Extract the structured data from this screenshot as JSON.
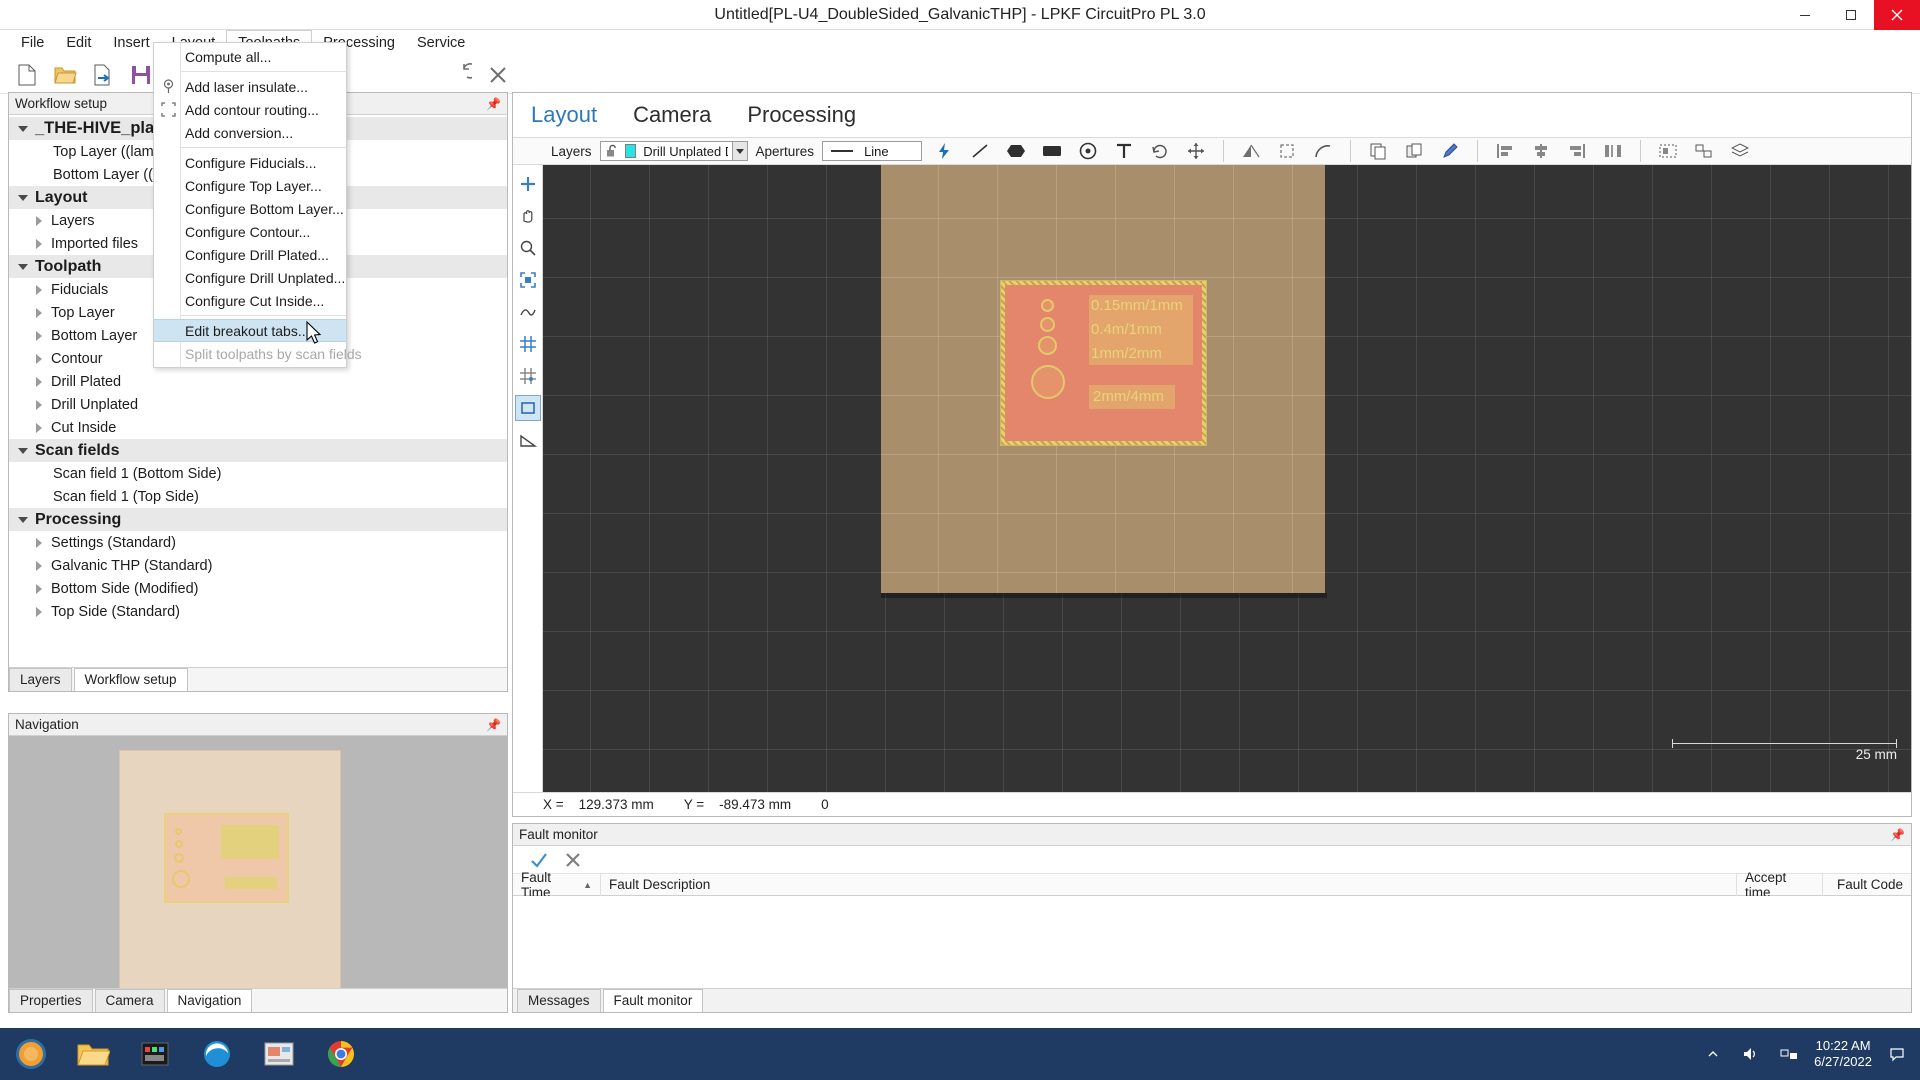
{
  "window": {
    "title": "Untitled[PL-U4_DoubleSided_GalvanicTHP] - LPKF CircuitPro PL 3.0",
    "minimize_label": "—",
    "maximize_label": "□",
    "close_label": "✕"
  },
  "menubar": {
    "items": [
      {
        "label": "File",
        "open": false
      },
      {
        "label": "Edit",
        "open": false
      },
      {
        "label": "Insert",
        "open": false
      },
      {
        "label": "Layout",
        "open": false
      },
      {
        "label": "Toolpaths",
        "open": true
      },
      {
        "label": "Processing",
        "open": false
      },
      {
        "label": "Service",
        "open": false
      }
    ]
  },
  "dropdown": {
    "owner": "Toolpaths",
    "items": [
      {
        "label": "Compute all...",
        "icon": "",
        "state": "normal"
      },
      {
        "separator": true
      },
      {
        "label": "Add laser insulate...",
        "icon": "laser-insulate-icon",
        "state": "normal"
      },
      {
        "label": "Add contour routing...",
        "icon": "contour-routing-icon",
        "state": "normal"
      },
      {
        "label": "Add conversion...",
        "icon": "",
        "state": "normal"
      },
      {
        "separator": true
      },
      {
        "label": "Configure Fiducials...",
        "icon": "",
        "state": "normal"
      },
      {
        "label": "Configure Top Layer...",
        "icon": "",
        "state": "normal"
      },
      {
        "label": "Configure Bottom Layer...",
        "icon": "",
        "state": "normal"
      },
      {
        "label": "Configure Contour...",
        "icon": "",
        "state": "normal"
      },
      {
        "label": "Configure Drill Plated...",
        "icon": "",
        "state": "normal"
      },
      {
        "label": "Configure Drill Unplated...",
        "icon": "",
        "state": "normal"
      },
      {
        "label": "Configure Cut Inside...",
        "icon": "",
        "state": "normal"
      },
      {
        "separator": true
      },
      {
        "label": "Edit breakout tabs...",
        "icon": "",
        "state": "highlighted"
      },
      {
        "label": "Split toolpaths by scan fields",
        "icon": "",
        "state": "disabled"
      }
    ]
  },
  "toolbar": {
    "buttons": [
      {
        "name": "new-document-icon"
      },
      {
        "name": "open-folder-icon"
      },
      {
        "name": "import-file-icon"
      },
      {
        "name": "save-icon"
      },
      {
        "separator": true
      },
      {
        "name": "undo-icon"
      },
      {
        "name": "redo-icon"
      },
      {
        "name": "delete-icon"
      }
    ]
  },
  "left_dock": {
    "title": "Workflow setup",
    "pin_icon": "pin-icon",
    "tree": [
      {
        "label": "_THE-HIVE_plated_P",
        "level": 0,
        "twisty": "down",
        "style": "root-selected"
      },
      {
        "label": "Top Layer ((laminated))",
        "level": 1,
        "twisty": "none",
        "style": "leaf"
      },
      {
        "label": "Bottom Layer ((laminated))",
        "level": 1,
        "twisty": "none",
        "style": "leaf"
      },
      {
        "label": "Layout",
        "level": 0,
        "twisty": "down",
        "style": "group"
      },
      {
        "label": "Layers",
        "level": 1,
        "twisty": "right",
        "style": "leaf"
      },
      {
        "label": "Imported files",
        "level": 1,
        "twisty": "right",
        "style": "leaf"
      },
      {
        "label": "Toolpath",
        "level": 0,
        "twisty": "down",
        "style": "group"
      },
      {
        "label": "Fiducials",
        "level": 1,
        "twisty": "right",
        "style": "leaf"
      },
      {
        "label": "Top Layer",
        "level": 1,
        "twisty": "right",
        "style": "leaf"
      },
      {
        "label": "Bottom Layer",
        "level": 1,
        "twisty": "right",
        "style": "leaf"
      },
      {
        "label": "Contour",
        "level": 1,
        "twisty": "right",
        "style": "leaf"
      },
      {
        "label": "Drill Plated",
        "level": 1,
        "twisty": "right",
        "style": "leaf"
      },
      {
        "label": "Drill Unplated",
        "level": 1,
        "twisty": "right",
        "style": "leaf"
      },
      {
        "label": "Cut Inside",
        "level": 1,
        "twisty": "right",
        "style": "leaf"
      },
      {
        "label": "Scan fields",
        "level": 0,
        "twisty": "down",
        "style": "group"
      },
      {
        "label": "Scan field 1 (Bottom Side)",
        "level": 1,
        "twisty": "none",
        "style": "leaf"
      },
      {
        "label": "Scan field 1 (Top Side)",
        "level": 1,
        "twisty": "none",
        "style": "leaf"
      },
      {
        "label": "Processing",
        "level": 0,
        "twisty": "down",
        "style": "group"
      },
      {
        "label": "Settings (Standard)",
        "level": 1,
        "twisty": "right",
        "style": "leaf"
      },
      {
        "label": "Galvanic THP (Standard)",
        "level": 1,
        "twisty": "right",
        "style": "leaf"
      },
      {
        "label": "Bottom Side (Modified)",
        "level": 1,
        "twisty": "right",
        "style": "leaf"
      },
      {
        "label": "Top Side (Standard)",
        "level": 1,
        "twisty": "right",
        "style": "leaf"
      }
    ],
    "tabs": [
      {
        "label": "Layers",
        "active": false
      },
      {
        "label": "Workflow setup",
        "active": true
      }
    ]
  },
  "navigation_dock": {
    "title": "Navigation",
    "pin_icon": "pin-icon",
    "tabs": [
      {
        "label": "Properties",
        "active": false
      },
      {
        "label": "Camera",
        "active": false
      },
      {
        "label": "Navigation",
        "active": true
      }
    ]
  },
  "main": {
    "view_tabs": [
      {
        "label": "Layout",
        "active": true
      },
      {
        "label": "Camera",
        "active": false
      },
      {
        "label": "Processing",
        "active": false
      }
    ],
    "controls": {
      "layers_label": "Layers",
      "layer_lock_icon": "unlock-icon",
      "layer_color": "#27e3e3",
      "layer_value": "Drill Unplated Dril",
      "apertures_label": "Apertures",
      "aperture_icon": "line-icon",
      "aperture_value": "Line"
    },
    "canvas_tools": [
      {
        "name": "add-tool",
        "icon": "plus-icon",
        "selected": false
      },
      {
        "name": "pan-tool",
        "icon": "hand-icon",
        "selected": false
      },
      {
        "name": "zoom-tool",
        "icon": "magnifier-icon",
        "selected": false
      },
      {
        "name": "fit-tool",
        "icon": "fit-screen-icon",
        "selected": false
      },
      {
        "name": "measure-tool",
        "icon": "curve-icon",
        "selected": false
      },
      {
        "name": "grid-tool",
        "icon": "grid-icon",
        "selected": false
      },
      {
        "name": "grid-snap-tool",
        "icon": "grid-snap-icon",
        "selected": false
      },
      {
        "name": "rect-select-tool",
        "icon": "rectangle-icon",
        "selected": true
      },
      {
        "name": "angle-tool",
        "icon": "angle-icon",
        "selected": false
      }
    ],
    "pcb_labels": [
      "0.15mm/1mm",
      "0.4m/1mm",
      "1mm/2mm",
      "2mm/4mm"
    ],
    "scale_label": "25 mm",
    "status": {
      "x_label": "X =",
      "x_value": "129.373 mm",
      "y_label": "Y =",
      "y_value": "-89.473 mm",
      "z_value": "0"
    }
  },
  "fault_monitor": {
    "title": "Fault monitor",
    "pin_icon": "pin-icon",
    "accept_icon": "check-icon",
    "clear_icon": "cross-icon",
    "columns": [
      {
        "label": "Fault Time",
        "sort": "asc"
      },
      {
        "label": "Fault Description",
        "sort": ""
      },
      {
        "label": "Accept time",
        "sort": ""
      },
      {
        "label": "Fault Code",
        "sort": ""
      }
    ],
    "rows": [],
    "tabs": [
      {
        "label": "Messages",
        "active": false
      },
      {
        "label": "Fault monitor",
        "active": true
      }
    ]
  },
  "taskbar": {
    "items": [
      {
        "name": "start-button",
        "icon": "windows-orb-icon"
      },
      {
        "name": "file-explorer-button",
        "icon": "folder-icon"
      },
      {
        "name": "media-app-button",
        "icon": "media-icon"
      },
      {
        "name": "edge-browser-button",
        "icon": "edge-icon"
      },
      {
        "name": "circuitpro-button",
        "icon": "circuitpro-icon"
      },
      {
        "name": "chrome-browser-button",
        "icon": "chrome-icon"
      }
    ],
    "tray": {
      "show_hidden_icon": "chevron-up-icon",
      "volume_icon": "speaker-icon",
      "network_icon": "network-icon",
      "action_center_icon": "notification-icon",
      "time": "10:22 AM",
      "date": "6/27/2022"
    }
  }
}
